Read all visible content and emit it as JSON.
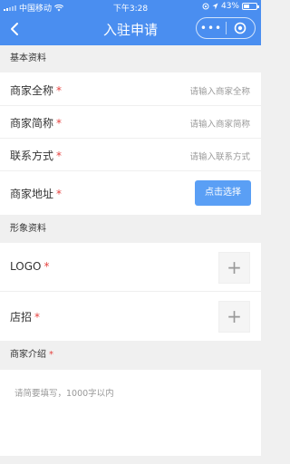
{
  "status_bar": {
    "carrier": "中国移动",
    "time": "下午3:28",
    "battery": "43%"
  },
  "nav": {
    "title": "入驻申请",
    "more_label": "•••"
  },
  "sections": {
    "basic": "基本资料",
    "image": "形象资料",
    "intro": "商家介绍"
  },
  "fields": {
    "full_name": {
      "label": "商家全称",
      "placeholder": "请输入商家全称"
    },
    "short_name": {
      "label": "商家简称",
      "placeholder": "请输入商家简称"
    },
    "contact": {
      "label": "联系方式",
      "placeholder": "请输入联系方式"
    },
    "address": {
      "label": "商家地址",
      "button": "点击选择"
    },
    "logo": {
      "label": "LOGO"
    },
    "sign": {
      "label": "店招"
    },
    "intro": {
      "placeholder": "请简要填写，1000字以内"
    }
  },
  "required_mark": "*",
  "upload_symbol": "+",
  "colors": {
    "brand": "#4a8ef0",
    "button": "#5a9ff5",
    "required": "#e64340"
  }
}
